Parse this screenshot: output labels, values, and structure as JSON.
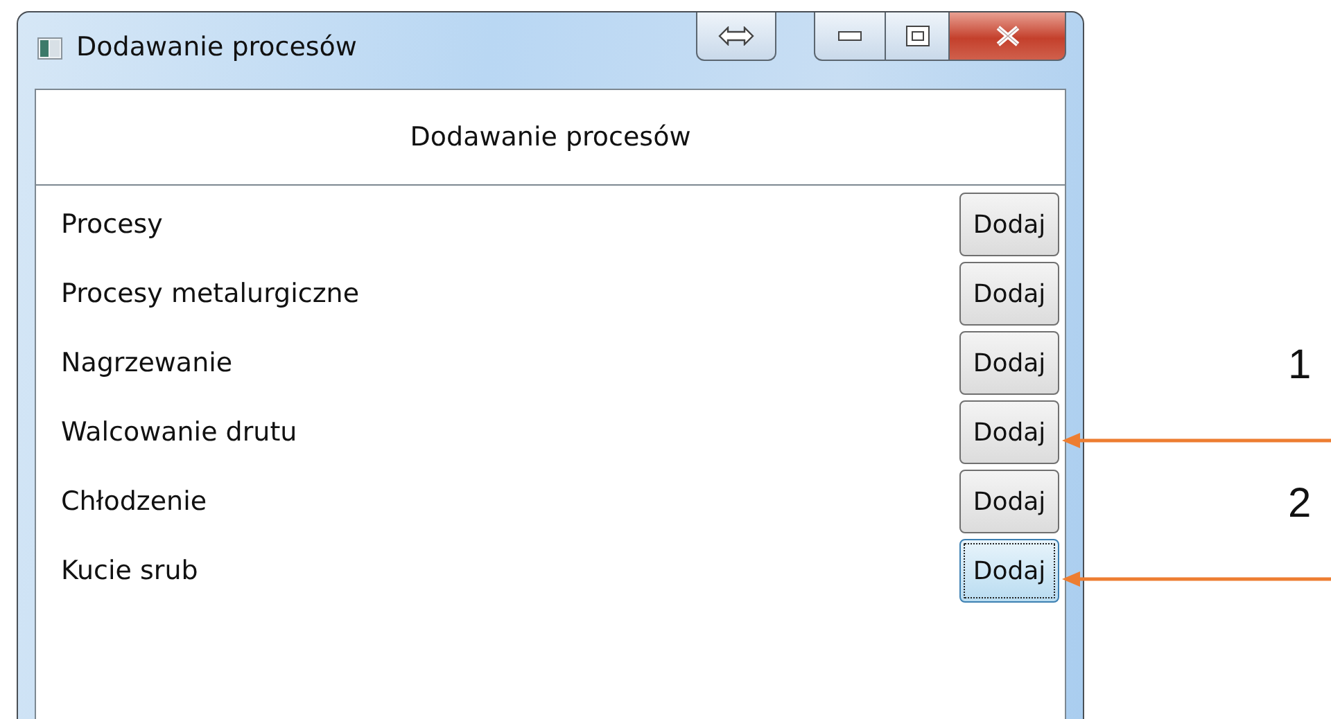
{
  "window": {
    "title": "Dodawanie procesów"
  },
  "header": "Dodawanie procesów",
  "processes": [
    {
      "label": "Procesy",
      "button": "Dodaj",
      "focused": false
    },
    {
      "label": "Procesy metalurgiczne",
      "button": "Dodaj",
      "focused": false
    },
    {
      "label": "Nagrzewanie",
      "button": "Dodaj",
      "focused": false
    },
    {
      "label": "Walcowanie drutu",
      "button": "Dodaj",
      "focused": false,
      "callout": "1"
    },
    {
      "label": "Chłodzenie",
      "button": "Dodaj",
      "focused": false
    },
    {
      "label": "Kucie srub",
      "button": "Dodaj",
      "focused": true,
      "callout": "2"
    }
  ]
}
